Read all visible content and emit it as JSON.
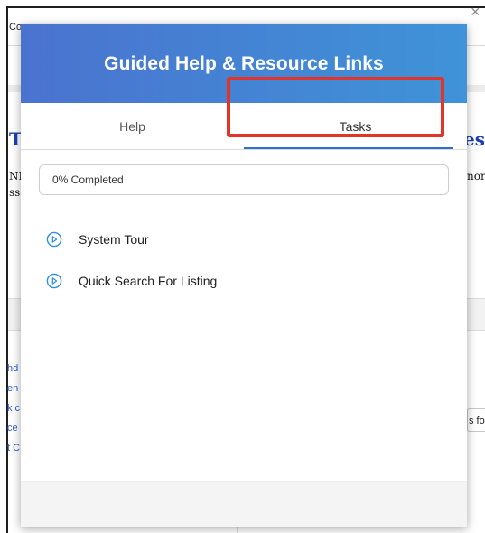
{
  "background": {
    "topbar_text": "Co",
    "title_left": "T",
    "title_right": "esp",
    "serif_left": [
      "NI",
      "ss"
    ],
    "serif_right": [
      "nor"
    ],
    "links": [
      "hd",
      "en",
      "k c",
      "ce",
      "t C"
    ],
    "field_text": "s fo",
    "close_label": "×"
  },
  "modal": {
    "title": "Guided Help & Resource Links",
    "tabs": [
      {
        "label": "Help",
        "active": false
      },
      {
        "label": "Tasks",
        "active": true
      }
    ],
    "progress_text": "0% Completed",
    "progress_value": 0,
    "tasks": [
      {
        "label": "System Tour",
        "icon": "play-circle-icon"
      },
      {
        "label": "Quick Search For Listing",
        "icon": "play-circle-icon"
      }
    ]
  },
  "colors": {
    "header_start": "#4a73cf",
    "header_end": "#3f93d8",
    "accent": "#2f6fd0",
    "highlight": "#e3342a"
  }
}
